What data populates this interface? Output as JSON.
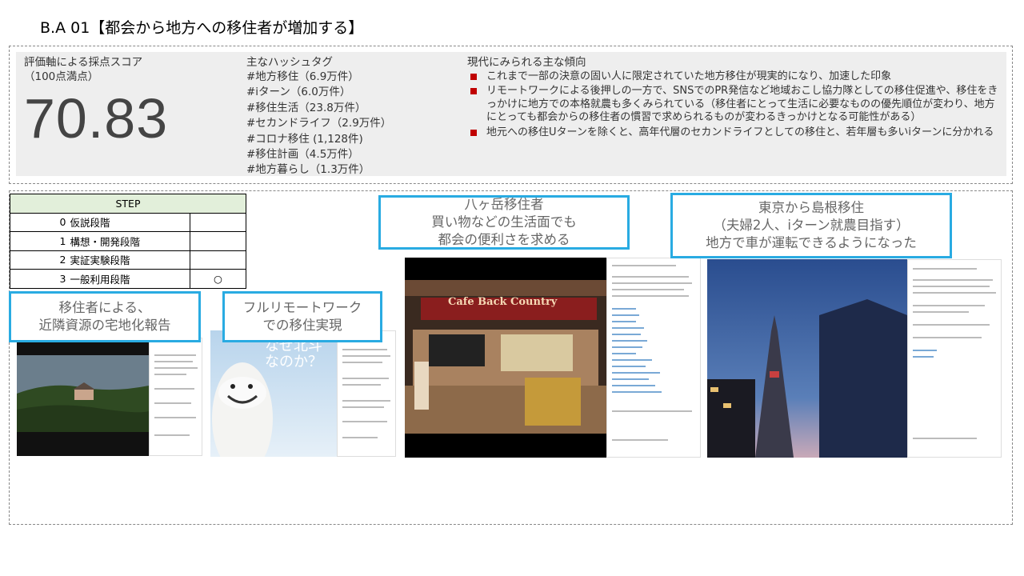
{
  "title": "B.A 01【都会から地方への移住者が増加する】",
  "score": {
    "label_line1": "評価軸による採点スコア",
    "label_line2": "（100点満点）",
    "value": "70.83"
  },
  "hashtags": {
    "label": "主なハッシュタグ",
    "items": [
      "#地方移住（6.9万件）",
      "#iターン（6.0万件）",
      "#移住生活（23.8万件）",
      "#セカンドライフ（2.9万件）",
      "#コロナ移住 (1,128件)",
      "#移住計画（4.5万件）",
      "#地方暮らし（1.3万件）"
    ]
  },
  "trends": {
    "label": "現代にみられる主な傾向",
    "accent_color": "#c00000",
    "items": [
      "これまで一部の決意の固い人に限定されていた地方移住が現実的になり、加速した印象",
      "リモートワークによる後押しの一方で、SNSでのPR発信など地域おこし協力隊としての移住促進や、移住をきっかけに地方での本格就農も多くみられている（移住者にとって生活に必要なものの優先順位が変わり、地方にとっても都会からの移住者の慣習で求められるものが変わるきっかけとなる可能性がある）",
      "地元への移住Uターンを除くと、高年代層のセカンドライフとしての移住と、若年層も多いiターンに分かれる"
    ]
  },
  "step_table": {
    "header": "STEP",
    "rows": [
      {
        "num": "0",
        "label": "仮説段階",
        "mark": ""
      },
      {
        "num": "1",
        "label": "構想・開発段階",
        "mark": ""
      },
      {
        "num": "2",
        "label": "実証実験段階",
        "mark": ""
      },
      {
        "num": "3",
        "label": "一般利用段階",
        "mark": "○"
      }
    ]
  },
  "callouts": {
    "c1": {
      "line1": "移住者による、",
      "line2": "近隣資源の宅地化報告"
    },
    "c2": {
      "line1": "フルリモートワーク",
      "line2": "での移住実現"
    },
    "c3": {
      "line1": "八ヶ岳移住者",
      "line2": "買い物などの生活面でも",
      "line3": "都会の便利さを求める"
    },
    "c4": {
      "line1": "東京から島根移住",
      "line2": "（夫婦2人、iターン就農目指す）",
      "line3": "地方で車が運転できるようになった"
    }
  },
  "images": {
    "img2_text": "なぜ北斗 なのか？",
    "img3_sign": "Cafe Back Country"
  },
  "callout_border_color": "#29abe2"
}
